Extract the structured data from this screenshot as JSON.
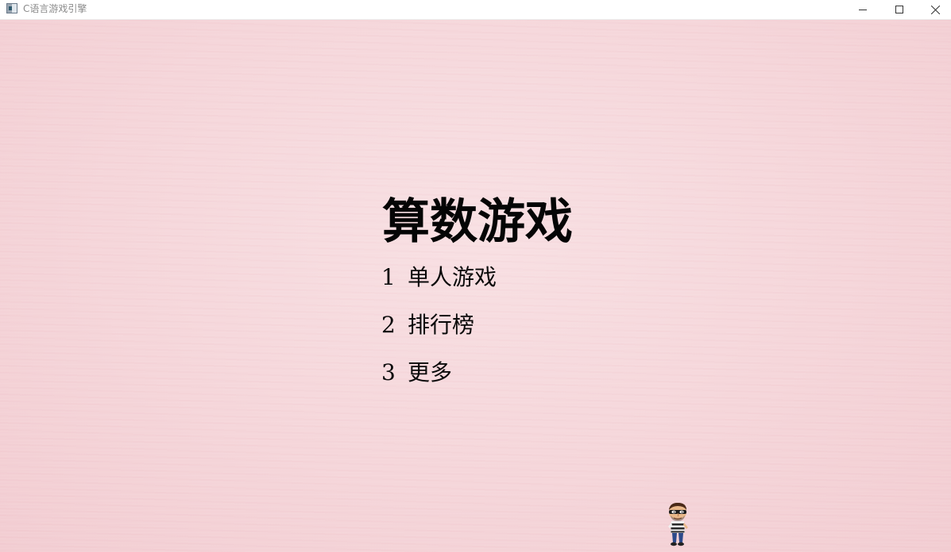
{
  "window": {
    "title": "C语言游戏引擎",
    "icon": "app-window-icon",
    "controls": [
      "minimize-icon",
      "maximize-icon",
      "close-icon"
    ]
  },
  "game": {
    "title": "算数游戏",
    "menu": [
      {
        "number": "1",
        "label": "单人游戏"
      },
      {
        "number": "2",
        "label": "排行榜"
      },
      {
        "number": "3",
        "label": "更多"
      }
    ],
    "character": "thief-character-sprite",
    "colors": {
      "background": "#f5d6da",
      "text": "#050505"
    }
  }
}
